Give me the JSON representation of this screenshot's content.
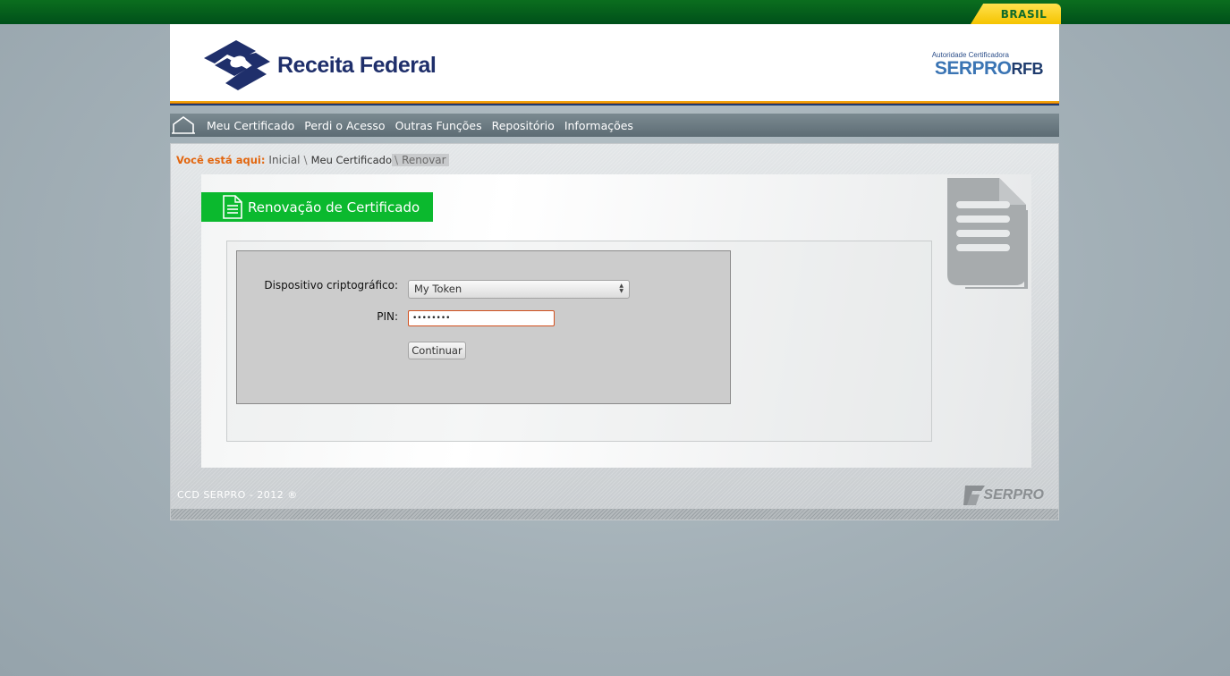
{
  "topbar": {
    "brasil_label": "BRASIL"
  },
  "header": {
    "logo_text": "Receita Federal",
    "serpro_small": "Autoridade Certificadora",
    "serpro_big": "SERPRO",
    "serpro_rfb": "RFB"
  },
  "nav": {
    "items": [
      {
        "label": "Meu Certificado"
      },
      {
        "label": "Perdi o Acesso"
      },
      {
        "label": "Outras Funções"
      },
      {
        "label": "Repositório"
      },
      {
        "label": "Informações"
      }
    ]
  },
  "breadcrumb": {
    "label": "Você está aqui:",
    "items": [
      "Inicial",
      "Meu Certificado",
      "Renovar"
    ],
    "separator": "\\"
  },
  "page": {
    "title": "Renovação de Certificado"
  },
  "form": {
    "device_label": "Dispositivo criptográfico:",
    "device_value": "My Token",
    "pin_label": "PIN:",
    "pin_value": "••••••••",
    "submit_label": "Continuar"
  },
  "footer": {
    "copyright": "CCD SERPRO - 2012 ®",
    "logo_text": "SERPRO"
  },
  "colors": {
    "topbar": "#00501a",
    "title_bar": "#0bb92e",
    "breadcrumb_label": "#e2660f",
    "nav_bg": "#6b7a82"
  }
}
